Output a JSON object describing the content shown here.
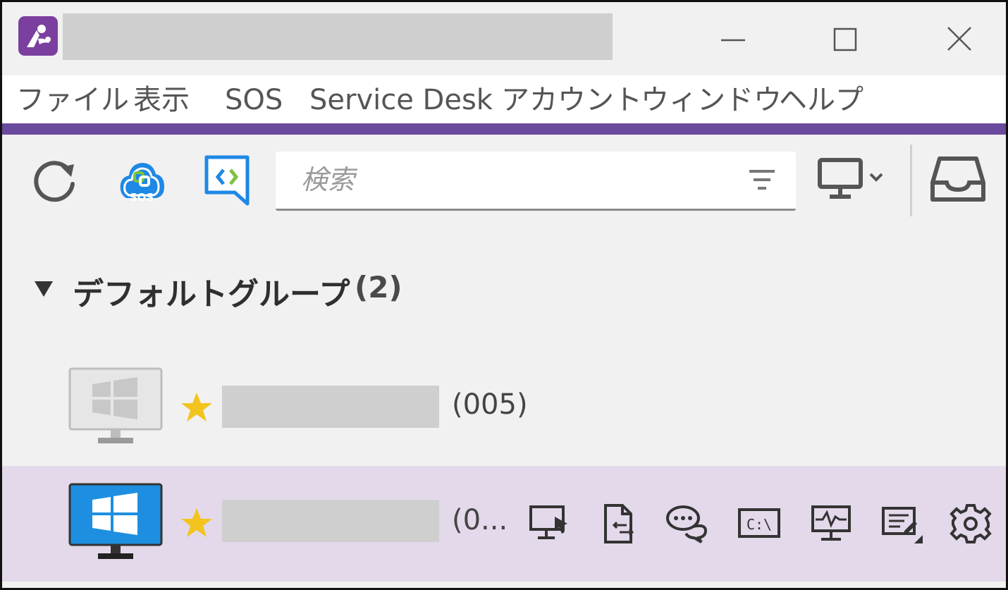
{
  "window": {
    "title": "",
    "controls": {
      "minimize": "minimize",
      "maximize": "maximize",
      "close": "close"
    }
  },
  "menu": {
    "items": [
      {
        "label": "ファイル"
      },
      {
        "label": "表示"
      },
      {
        "label": "SOS"
      },
      {
        "label": "Service Desk"
      },
      {
        "label": "アカウント"
      },
      {
        "label": "ウィンドウ"
      },
      {
        "label": "ヘルプ"
      }
    ]
  },
  "colors": {
    "accent": "#6a4a9c",
    "brand": "#7b3fa0",
    "selected_row": "#e3d9ea",
    "star": "#f2c41d",
    "sos_blue": "#1e88e5",
    "sos_green": "#7cc242"
  },
  "toolbar": {
    "icons": [
      "refresh-icon",
      "sos-icon",
      "service-desk-icon",
      "monitor-view-icon",
      "inbox-icon"
    ],
    "search": {
      "placeholder": "検索",
      "value": ""
    }
  },
  "group": {
    "name": "デフォルトグループ",
    "count": "(2)",
    "expanded": true
  },
  "computers": [
    {
      "name": "",
      "id": "(005)",
      "favorite": true,
      "online": false,
      "selected": false
    },
    {
      "name": "",
      "id": "(0...",
      "favorite": true,
      "online": true,
      "selected": true,
      "actions": [
        "remote-view-icon",
        "file-transfer-icon",
        "chat-icon",
        "command-prompt-icon",
        "system-diagnostics-icon",
        "remote-script-icon",
        "settings-icon"
      ]
    }
  ]
}
